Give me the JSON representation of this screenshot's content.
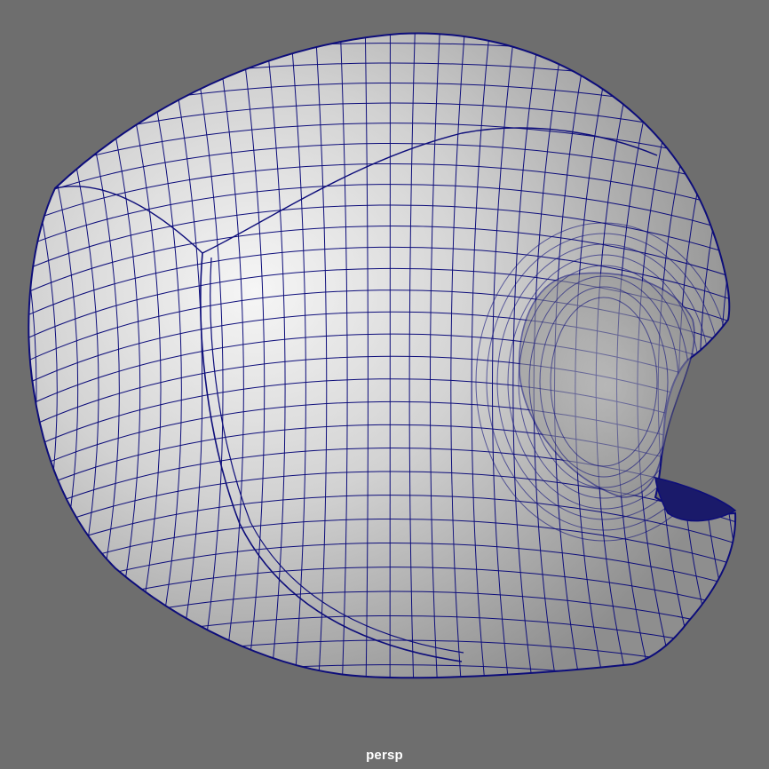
{
  "viewport": {
    "camera_name": "persp",
    "background_color": "#6e6e6e"
  },
  "model": {
    "object": "helmet-mesh",
    "display_mode": "wireframe-on-shaded",
    "wire_color": "#0d0d7a",
    "shade_light": "#f4f4f4",
    "shade_dark": "#8c8c8c"
  }
}
